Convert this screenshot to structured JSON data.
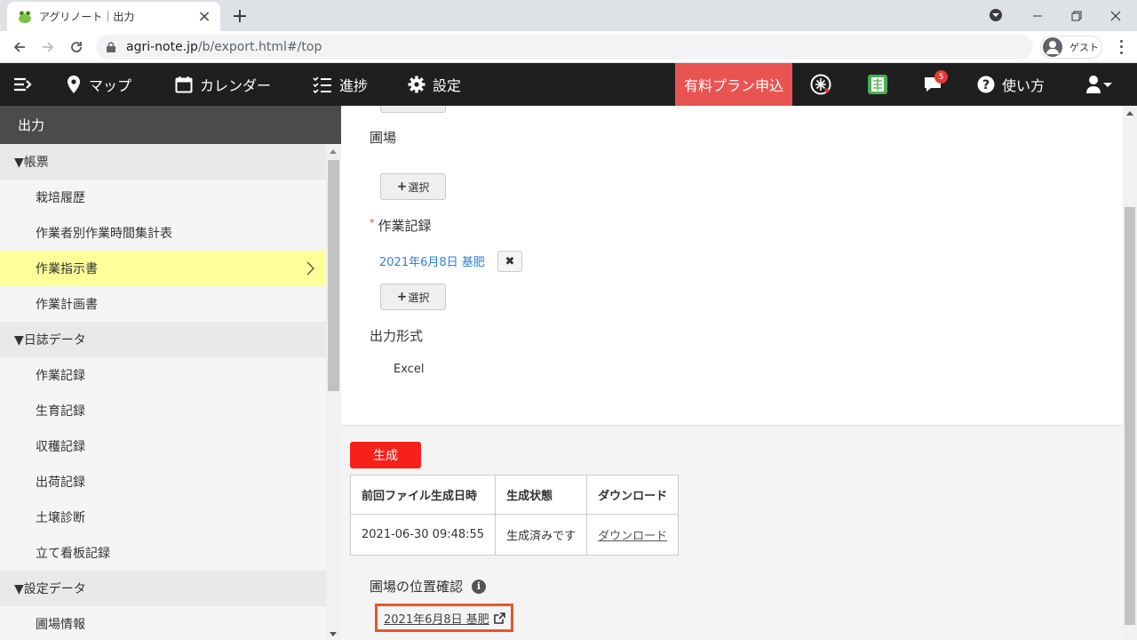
{
  "browser": {
    "tab_title": "アグリノート｜出力",
    "url_host": "agri-note.jp",
    "url_path": "/b/export.html#/top",
    "guest_label": "ゲスト"
  },
  "nav": {
    "map": "マップ",
    "calendar": "カレンダー",
    "progress": "進捗",
    "settings": "設定",
    "paid_plan": "有料プラン申込",
    "notification_count": "5",
    "help": "使い方"
  },
  "sidebar": {
    "header": "出力",
    "groups": [
      {
        "label": "▼帳票",
        "items": [
          "栽培履歴",
          "作業者別作業時間集計表",
          "作業指示書",
          "作業計画書"
        ]
      },
      {
        "label": "▼日誌データ",
        "items": [
          "作業記録",
          "生育記録",
          "収穫記録",
          "出荷記録",
          "土壌診断",
          "立て看板記録"
        ]
      },
      {
        "label": "▼設定データ",
        "items": [
          "圃場情報"
        ]
      }
    ],
    "active_item": "作業指示書"
  },
  "form": {
    "field_label": "圃場",
    "select_label": "選択",
    "record_label": "作業記録",
    "required_mark": "*",
    "record_value": "2021年6月8日 基肥",
    "remove_symbol": "✖",
    "output_format_label": "出力形式",
    "output_format_value": "Excel"
  },
  "generate": {
    "button_label": "生成",
    "headers": [
      "前回ファイル生成日時",
      "生成状態",
      "ダウンロード"
    ],
    "row": {
      "datetime": "2021-06-30 09:48:55",
      "status": "生成済みです",
      "download": "ダウンロード"
    }
  },
  "location": {
    "label": "圃場の位置確認",
    "link": "2021年6月8日 基肥"
  },
  "colors": {
    "accent_red": "#f5211a",
    "paid_plan_bg": "#e95452",
    "highlight_yellow": "#ffff99",
    "link_blue": "#2f7fd0",
    "focus_box": "#e8562a"
  }
}
